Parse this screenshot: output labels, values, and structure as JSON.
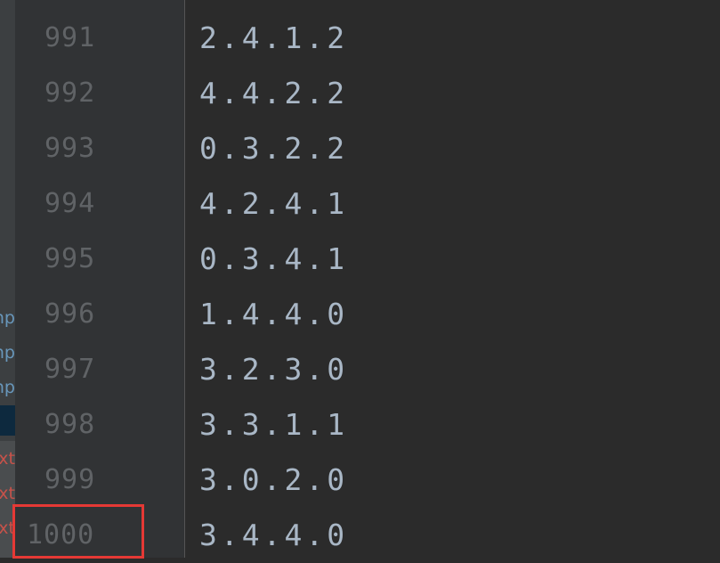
{
  "side_panel": {
    "items": [
      {
        "text": "np",
        "color": "blue"
      },
      {
        "text": "np",
        "color": "blue"
      },
      {
        "text": "np",
        "color": "blue"
      },
      {
        "text": "xt",
        "color": "red"
      },
      {
        "text": "xt",
        "color": "red"
      },
      {
        "text": "xt",
        "color": "red"
      }
    ]
  },
  "editor": {
    "lines": [
      {
        "number": "991",
        "text": "2.4.1.2"
      },
      {
        "number": "992",
        "text": "4.4.2.2"
      },
      {
        "number": "993",
        "text": "0.3.2.2"
      },
      {
        "number": "994",
        "text": "4.2.4.1"
      },
      {
        "number": "995",
        "text": "0.3.4.1"
      },
      {
        "number": "996",
        "text": "1.4.4.0"
      },
      {
        "number": "997",
        "text": "3.2.3.0"
      },
      {
        "number": "998",
        "text": "3.3.1.1"
      },
      {
        "number": "999",
        "text": "3.0.2.0"
      },
      {
        "number": "1000",
        "text": "3.4.4.0"
      }
    ]
  },
  "colors": {
    "background": "#2b2b2b",
    "gutter": "#313335",
    "line_number": "#606366",
    "code_text": "#a9b7c6",
    "highlight": "#e53935"
  }
}
